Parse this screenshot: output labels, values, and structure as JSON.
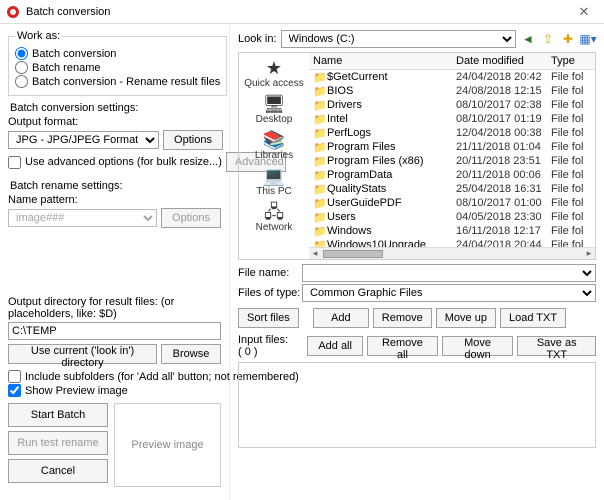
{
  "window": {
    "title": "Batch conversion",
    "icon": "irfanview-icon"
  },
  "workas": {
    "legend": "Work as:",
    "opt_conv": "Batch conversion",
    "opt_rename": "Batch rename",
    "opt_both": "Batch conversion - Rename result files",
    "selected": "conv"
  },
  "convsettings": {
    "legend": "Batch conversion settings:",
    "format_label": "Output format:",
    "format_value": "JPG - JPG/JPEG Format",
    "options_btn": "Options",
    "adv_chk_label": "Use advanced options (for bulk resize...)",
    "adv_btn": "Advanced"
  },
  "renamesettings": {
    "legend": "Batch rename settings:",
    "pattern_label": "Name pattern:",
    "pattern_value": "image###",
    "options_btn": "Options"
  },
  "output": {
    "label": "Output directory for result files: (or placeholders, like: $D)",
    "path": "C:\\TEMP",
    "use_current_btn": "Use current ('look in') directory",
    "browse_btn": "Browse"
  },
  "opts": {
    "include_subfolders": "Include subfolders (for 'Add all' button; not remembered)",
    "show_preview": "Show Preview image"
  },
  "actions": {
    "start": "Start Batch",
    "testrename": "Run test rename",
    "cancel": "Cancel",
    "preview_label": "Preview image"
  },
  "lookin": {
    "label": "Look in:",
    "value": "Windows (C:)",
    "toolbar": [
      "back-icon",
      "up-icon",
      "newfolder-icon",
      "views-icon"
    ]
  },
  "sidebar": {
    "items": [
      {
        "label": "Quick access",
        "icon": "★",
        "name": "sb-quick-access"
      },
      {
        "label": "Desktop",
        "icon": "🖥",
        "name": "sb-desktop"
      },
      {
        "label": "Libraries",
        "icon": "📚",
        "name": "sb-libraries"
      },
      {
        "label": "This PC",
        "icon": "💻",
        "name": "sb-this-pc"
      },
      {
        "label": "Network",
        "icon": "🖧",
        "name": "sb-network"
      }
    ]
  },
  "columns": {
    "name": "Name",
    "date": "Date modified",
    "type": "Type"
  },
  "files": [
    {
      "name": "$GetCurrent",
      "date": "24/04/2018 20:42",
      "type": "File fol"
    },
    {
      "name": "BIOS",
      "date": "24/08/2018 12:15",
      "type": "File fol"
    },
    {
      "name": "Drivers",
      "date": "08/10/2017 02:38",
      "type": "File fol"
    },
    {
      "name": "Intel",
      "date": "08/10/2017 01:19",
      "type": "File fol"
    },
    {
      "name": "PerfLogs",
      "date": "12/04/2018 00:38",
      "type": "File fol"
    },
    {
      "name": "Program Files",
      "date": "21/11/2018 01:04",
      "type": "File fol"
    },
    {
      "name": "Program Files (x86)",
      "date": "20/11/2018 23:51",
      "type": "File fol"
    },
    {
      "name": "ProgramData",
      "date": "20/11/2018 00:06",
      "type": "File fol"
    },
    {
      "name": "QualityStats",
      "date": "25/04/2018 16:31",
      "type": "File fol"
    },
    {
      "name": "UserGuidePDF",
      "date": "08/10/2017 01:00",
      "type": "File fol"
    },
    {
      "name": "Users",
      "date": "04/05/2018 23:30",
      "type": "File fol"
    },
    {
      "name": "Windows",
      "date": "16/11/2018 12:17",
      "type": "File fol"
    },
    {
      "name": "Windows10Upgrade",
      "date": "24/04/2018 20:44",
      "type": "File fol"
    }
  ],
  "filefields": {
    "filename_label": "File name:",
    "filename_value": "",
    "filetype_label": "Files of type:",
    "filetype_value": "Common Graphic Files"
  },
  "filebuttons": {
    "sort": "Sort files",
    "add": "Add",
    "remove": "Remove",
    "moveup": "Move up",
    "loadtxt": "Load TXT",
    "addall": "Add all",
    "removeall": "Remove all",
    "movedown": "Move down",
    "savetxt": "Save as TXT",
    "inputfiles_label": "Input files: ( 0 )"
  }
}
